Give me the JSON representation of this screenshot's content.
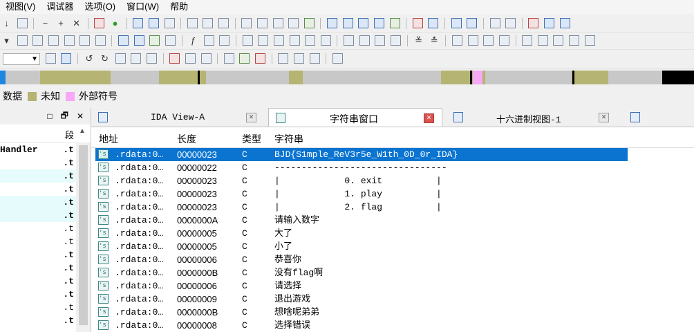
{
  "menu": [
    "视图(V)",
    "调试器",
    "选项(O)",
    "窗口(W)",
    "帮助"
  ],
  "legend": [
    {
      "label": "数据",
      "color": ""
    },
    {
      "label": "未知",
      "color": "#b5b473"
    },
    {
      "label": "外部符号",
      "color": "#f7a8f7"
    }
  ],
  "left_pane": {
    "col_header": "段",
    "rows": [
      {
        "name": "Handler",
        "seg": ".t",
        "hl": false
      },
      {
        "name": "",
        "seg": ".t",
        "hl": false
      },
      {
        "name": "",
        "seg": ".t",
        "hl": true
      },
      {
        "name": "",
        "seg": ".t",
        "hl": false
      },
      {
        "name": "",
        "seg": ".t",
        "hl": true
      },
      {
        "name": "",
        "seg": ".t",
        "hl": true
      },
      {
        "name": "",
        "seg": ".t",
        "hl": false
      },
      {
        "name": "",
        "seg": ".t",
        "hl": false
      },
      {
        "name": "",
        "seg": ".t",
        "hl": false
      },
      {
        "name": "",
        "seg": ".t",
        "hl": false
      },
      {
        "name": "",
        "seg": ".t",
        "hl": false
      },
      {
        "name": "",
        "seg": ".t",
        "hl": false
      },
      {
        "name": "",
        "seg": ".t",
        "hl": false
      },
      {
        "name": "",
        "seg": ".t",
        "hl": false
      }
    ]
  },
  "tabs": [
    "IDA View-A",
    "字符串窗口",
    "十六进制视图-1"
  ],
  "strings_window": {
    "headers": [
      "地址",
      "长度",
      "类型",
      "字符串"
    ],
    "rows": [
      {
        "address": ".rdata:0…",
        "length": "00000023",
        "type": "C",
        "string": "BJD{S1mple_ReV3r5e_W1th_0D_0r_IDA}",
        "selected": true
      },
      {
        "address": ".rdata:0…",
        "length": "00000022",
        "type": "C",
        "string": "--------------------------------"
      },
      {
        "address": ".rdata:0…",
        "length": "00000023",
        "type": "C",
        "string": "|            0. exit          |"
      },
      {
        "address": ".rdata:0…",
        "length": "00000023",
        "type": "C",
        "string": "|            1. play          |"
      },
      {
        "address": ".rdata:0…",
        "length": "00000023",
        "type": "C",
        "string": "|            2. flag          |"
      },
      {
        "address": ".rdata:0…",
        "length": "0000000A",
        "type": "C",
        "string": "请输入数字"
      },
      {
        "address": ".rdata:0…",
        "length": "00000005",
        "type": "C",
        "string": "大了"
      },
      {
        "address": ".rdata:0…",
        "length": "00000005",
        "type": "C",
        "string": "小了"
      },
      {
        "address": ".rdata:0…",
        "length": "00000006",
        "type": "C",
        "string": "恭喜你"
      },
      {
        "address": ".rdata:0…",
        "length": "0000000B",
        "type": "C",
        "string": "没有flag啊"
      },
      {
        "address": ".rdata:0…",
        "length": "00000006",
        "type": "C",
        "string": "请选择"
      },
      {
        "address": ".rdata:0…",
        "length": "00000009",
        "type": "C",
        "string": "退出游戏"
      },
      {
        "address": ".rdata:0…",
        "length": "0000000B",
        "type": "C",
        "string": "想啥呢弟弟"
      },
      {
        "address": ".rdata:0…",
        "length": "00000008",
        "type": "C",
        "string": "选择错误"
      }
    ]
  },
  "colors": {
    "selection": "#0b74d1",
    "unknown": "#b5b473",
    "external": "#f7a8f7",
    "data": "#c8c8c8"
  }
}
